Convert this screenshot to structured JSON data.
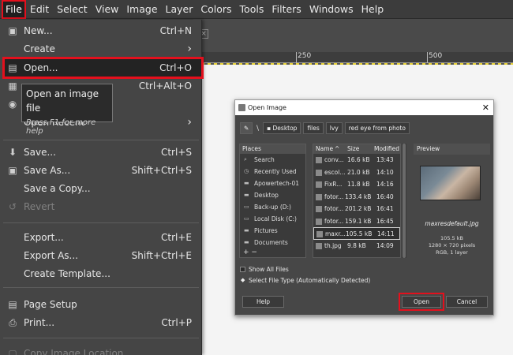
{
  "menubar": {
    "items": [
      "File",
      "Edit",
      "Select",
      "View",
      "Image",
      "Layer",
      "Colors",
      "Tools",
      "Filters",
      "Windows",
      "Help"
    ]
  },
  "ruler": {
    "labels": [
      "250",
      "500"
    ]
  },
  "file_menu": {
    "new": {
      "label": "New...",
      "shortcut": "Ctrl+N"
    },
    "create": {
      "label": "Create"
    },
    "open": {
      "label": "Open...",
      "shortcut": "Ctrl+O"
    },
    "open_as_layers": {
      "shortcut": "Ctrl+Alt+O"
    },
    "open_recent": {
      "label": "Open Recent"
    },
    "save": {
      "label": "Save...",
      "shortcut": "Ctrl+S"
    },
    "save_as": {
      "label": "Save As...",
      "shortcut": "Shift+Ctrl+S"
    },
    "save_copy": {
      "label": "Save a Copy..."
    },
    "revert": {
      "label": "Revert"
    },
    "export": {
      "label": "Export...",
      "shortcut": "Ctrl+E"
    },
    "export_as": {
      "label": "Export As...",
      "shortcut": "Shift+Ctrl+E"
    },
    "create_template": {
      "label": "Create Template..."
    },
    "page_setup": {
      "label": "Page Setup"
    },
    "print": {
      "label": "Print...",
      "shortcut": "Ctrl+P"
    },
    "copy_location": {
      "label": "Copy Image Location"
    }
  },
  "tooltip": {
    "title": "Open an image file",
    "hint": "Press F1 for more help"
  },
  "dialog": {
    "title": "Open Image",
    "breadcrumbs": [
      "Desktop",
      "files",
      "lvy",
      "red eye from photo"
    ],
    "places_header": "Places",
    "places": [
      "Search",
      "Recently Used",
      "Apowertech-01",
      "Desktop",
      "Back-up (D:)",
      "Local Disk (C:)",
      "Pictures",
      "Documents"
    ],
    "places_footer": "+ −",
    "files_header": {
      "name": "Name",
      "size": "Size",
      "modified": "Modified"
    },
    "files": [
      {
        "name": "conv...",
        "size": "16.6 kB",
        "modified": "13:43"
      },
      {
        "name": "escol...",
        "size": "21.0 kB",
        "modified": "14:10"
      },
      {
        "name": "FixR...",
        "size": "11.8 kB",
        "modified": "14:16"
      },
      {
        "name": "fotor...",
        "size": "133.4 kB",
        "modified": "16:40"
      },
      {
        "name": "fotor...",
        "size": "201.2 kB",
        "modified": "16:41"
      },
      {
        "name": "fotor...",
        "size": "159.1 kB",
        "modified": "16:45"
      },
      {
        "name": "maxr...",
        "size": "105.5 kB",
        "modified": "14:11"
      },
      {
        "name": "th.jpg",
        "size": "9.8 kB",
        "modified": "14:09"
      }
    ],
    "preview": {
      "header": "Preview",
      "filename": "maxresdefault.jpg",
      "size": "105.5 kB",
      "dimensions": "1280 × 720 pixels",
      "mode": "RGB, 1 layer"
    },
    "show_all_files": "Show All Files",
    "select_file_type": "Select File Type (Automatically Detected)",
    "help_label": "Help",
    "open_label": "Open",
    "cancel_label": "Cancel"
  }
}
